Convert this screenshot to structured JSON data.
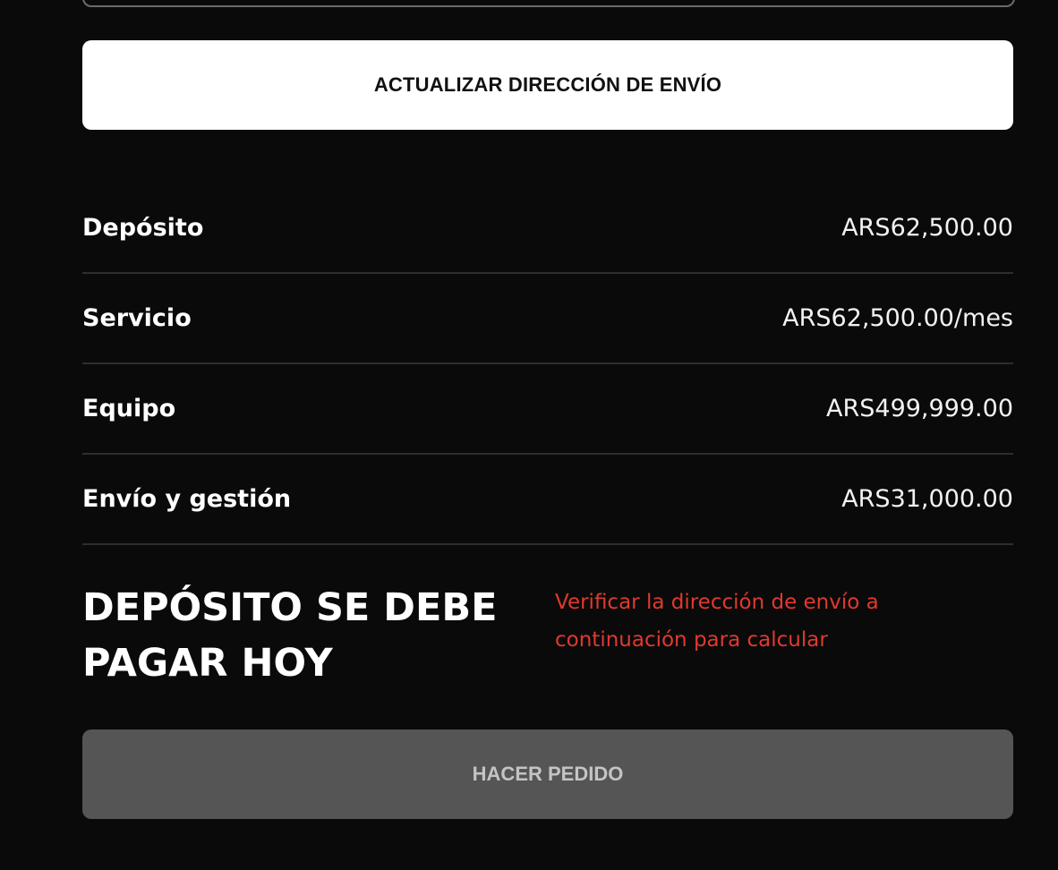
{
  "shipping": {
    "update_button_label": "ACTUALIZAR DIRECCIÓN DE ENVÍO"
  },
  "summary": {
    "rows": [
      {
        "label": "Depósito",
        "value": "ARS62,500.00"
      },
      {
        "label": "Servicio",
        "value": "ARS62,500.00/mes"
      },
      {
        "label": "Equipo",
        "value": "ARS499,999.00"
      },
      {
        "label": "Envío y gestión",
        "value": "ARS31,000.00"
      }
    ]
  },
  "due_today": {
    "title": "DEPÓSITO SE DEBE PAGAR HOY",
    "note": "Verificar la dirección de envío a continuación para calcular",
    "note_color": "#e0392f"
  },
  "order": {
    "button_label": "HACER PEDIDO",
    "disabled": true
  }
}
